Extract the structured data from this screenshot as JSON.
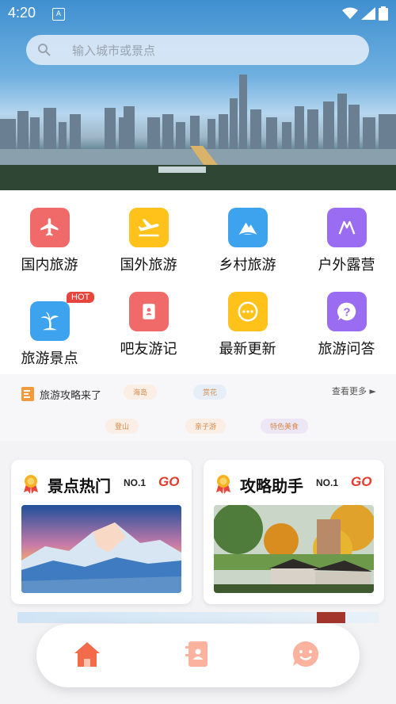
{
  "status_bar": {
    "time": "4:20",
    "app_badge": "A"
  },
  "search": {
    "placeholder": "输入城市或景点"
  },
  "categories": [
    {
      "label": "国内旅游",
      "icon": "airplane-icon",
      "color": "#f16a6a"
    },
    {
      "label": "国外旅游",
      "icon": "plane-takeoff-icon",
      "color": "#ffc21a"
    },
    {
      "label": "乡村旅游",
      "icon": "mountain-icon",
      "color": "#3ea3ef"
    },
    {
      "label": "户外露营",
      "icon": "tent-icon",
      "color": "#9a6cf2"
    },
    {
      "label": "旅游景点",
      "icon": "palm-tree-icon",
      "color": "#3ea3ef"
    },
    {
      "label": "吧友游记",
      "icon": "contact-book-icon",
      "color": "#f16a6a"
    },
    {
      "label": "最新更新",
      "icon": "chat-dots-icon",
      "color": "#ffc21a"
    },
    {
      "label": "旅游问答",
      "icon": "question-icon",
      "color": "#9a6cf2"
    }
  ],
  "hot_badge": "HOT",
  "guide": {
    "title": "旅游攻略来了",
    "more": "查看更多 ►",
    "tags": [
      "海岛",
      "赏花",
      "登山",
      "亲子游",
      "特色美食"
    ]
  },
  "cards": [
    {
      "title": "景点热门",
      "no1": "NO.1",
      "go": "GO"
    },
    {
      "title": "攻略助手",
      "no1": "NO.1",
      "go": "GO"
    }
  ],
  "nav": [
    "home-icon",
    "notebook-icon",
    "chat-face-icon"
  ]
}
